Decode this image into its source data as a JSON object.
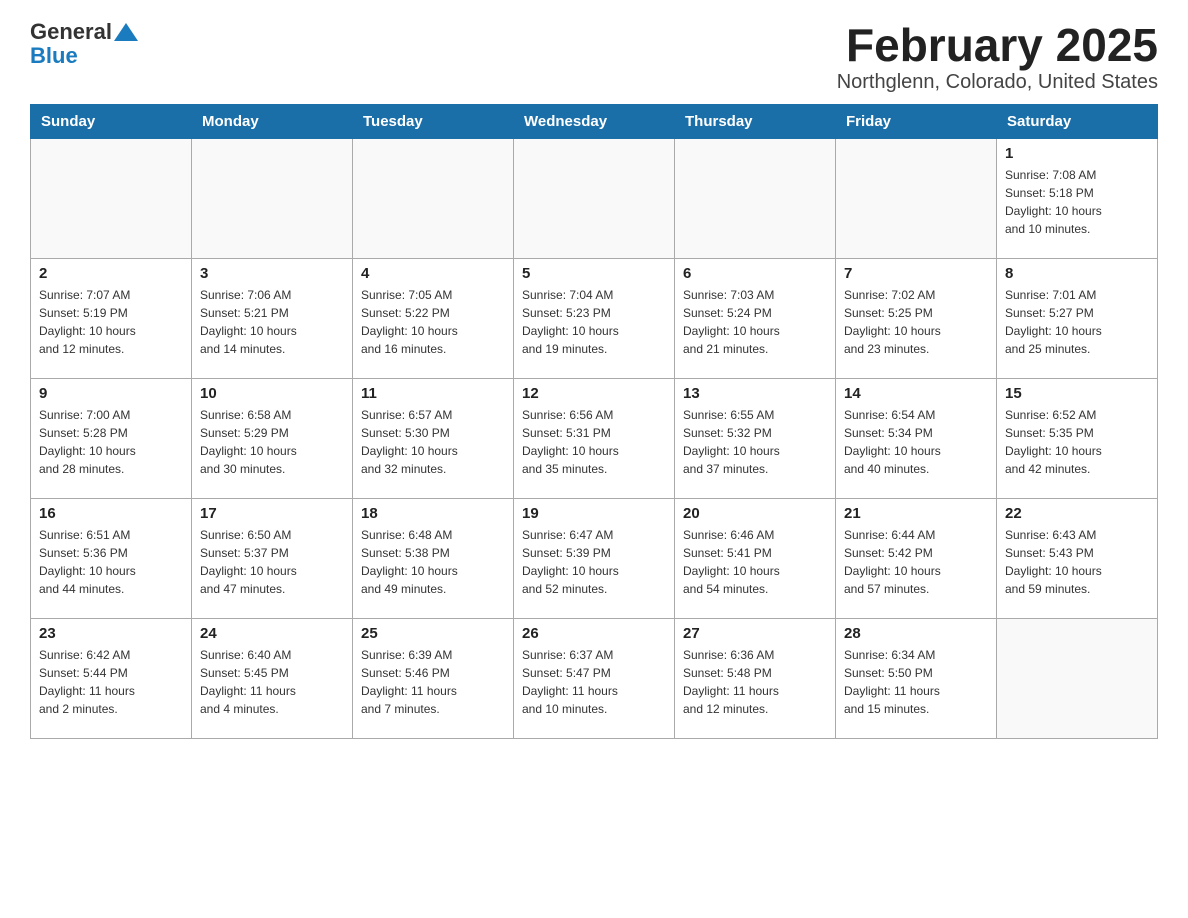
{
  "header": {
    "logo_general": "General",
    "logo_blue": "Blue",
    "title": "February 2025",
    "subtitle": "Northglenn, Colorado, United States"
  },
  "weekdays": [
    "Sunday",
    "Monday",
    "Tuesday",
    "Wednesday",
    "Thursday",
    "Friday",
    "Saturday"
  ],
  "weeks": [
    [
      {
        "day": "",
        "info": ""
      },
      {
        "day": "",
        "info": ""
      },
      {
        "day": "",
        "info": ""
      },
      {
        "day": "",
        "info": ""
      },
      {
        "day": "",
        "info": ""
      },
      {
        "day": "",
        "info": ""
      },
      {
        "day": "1",
        "info": "Sunrise: 7:08 AM\nSunset: 5:18 PM\nDaylight: 10 hours\nand 10 minutes."
      }
    ],
    [
      {
        "day": "2",
        "info": "Sunrise: 7:07 AM\nSunset: 5:19 PM\nDaylight: 10 hours\nand 12 minutes."
      },
      {
        "day": "3",
        "info": "Sunrise: 7:06 AM\nSunset: 5:21 PM\nDaylight: 10 hours\nand 14 minutes."
      },
      {
        "day": "4",
        "info": "Sunrise: 7:05 AM\nSunset: 5:22 PM\nDaylight: 10 hours\nand 16 minutes."
      },
      {
        "day": "5",
        "info": "Sunrise: 7:04 AM\nSunset: 5:23 PM\nDaylight: 10 hours\nand 19 minutes."
      },
      {
        "day": "6",
        "info": "Sunrise: 7:03 AM\nSunset: 5:24 PM\nDaylight: 10 hours\nand 21 minutes."
      },
      {
        "day": "7",
        "info": "Sunrise: 7:02 AM\nSunset: 5:25 PM\nDaylight: 10 hours\nand 23 minutes."
      },
      {
        "day": "8",
        "info": "Sunrise: 7:01 AM\nSunset: 5:27 PM\nDaylight: 10 hours\nand 25 minutes."
      }
    ],
    [
      {
        "day": "9",
        "info": "Sunrise: 7:00 AM\nSunset: 5:28 PM\nDaylight: 10 hours\nand 28 minutes."
      },
      {
        "day": "10",
        "info": "Sunrise: 6:58 AM\nSunset: 5:29 PM\nDaylight: 10 hours\nand 30 minutes."
      },
      {
        "day": "11",
        "info": "Sunrise: 6:57 AM\nSunset: 5:30 PM\nDaylight: 10 hours\nand 32 minutes."
      },
      {
        "day": "12",
        "info": "Sunrise: 6:56 AM\nSunset: 5:31 PM\nDaylight: 10 hours\nand 35 minutes."
      },
      {
        "day": "13",
        "info": "Sunrise: 6:55 AM\nSunset: 5:32 PM\nDaylight: 10 hours\nand 37 minutes."
      },
      {
        "day": "14",
        "info": "Sunrise: 6:54 AM\nSunset: 5:34 PM\nDaylight: 10 hours\nand 40 minutes."
      },
      {
        "day": "15",
        "info": "Sunrise: 6:52 AM\nSunset: 5:35 PM\nDaylight: 10 hours\nand 42 minutes."
      }
    ],
    [
      {
        "day": "16",
        "info": "Sunrise: 6:51 AM\nSunset: 5:36 PM\nDaylight: 10 hours\nand 44 minutes."
      },
      {
        "day": "17",
        "info": "Sunrise: 6:50 AM\nSunset: 5:37 PM\nDaylight: 10 hours\nand 47 minutes."
      },
      {
        "day": "18",
        "info": "Sunrise: 6:48 AM\nSunset: 5:38 PM\nDaylight: 10 hours\nand 49 minutes."
      },
      {
        "day": "19",
        "info": "Sunrise: 6:47 AM\nSunset: 5:39 PM\nDaylight: 10 hours\nand 52 minutes."
      },
      {
        "day": "20",
        "info": "Sunrise: 6:46 AM\nSunset: 5:41 PM\nDaylight: 10 hours\nand 54 minutes."
      },
      {
        "day": "21",
        "info": "Sunrise: 6:44 AM\nSunset: 5:42 PM\nDaylight: 10 hours\nand 57 minutes."
      },
      {
        "day": "22",
        "info": "Sunrise: 6:43 AM\nSunset: 5:43 PM\nDaylight: 10 hours\nand 59 minutes."
      }
    ],
    [
      {
        "day": "23",
        "info": "Sunrise: 6:42 AM\nSunset: 5:44 PM\nDaylight: 11 hours\nand 2 minutes."
      },
      {
        "day": "24",
        "info": "Sunrise: 6:40 AM\nSunset: 5:45 PM\nDaylight: 11 hours\nand 4 minutes."
      },
      {
        "day": "25",
        "info": "Sunrise: 6:39 AM\nSunset: 5:46 PM\nDaylight: 11 hours\nand 7 minutes."
      },
      {
        "day": "26",
        "info": "Sunrise: 6:37 AM\nSunset: 5:47 PM\nDaylight: 11 hours\nand 10 minutes."
      },
      {
        "day": "27",
        "info": "Sunrise: 6:36 AM\nSunset: 5:48 PM\nDaylight: 11 hours\nand 12 minutes."
      },
      {
        "day": "28",
        "info": "Sunrise: 6:34 AM\nSunset: 5:50 PM\nDaylight: 11 hours\nand 15 minutes."
      },
      {
        "day": "",
        "info": ""
      }
    ]
  ]
}
